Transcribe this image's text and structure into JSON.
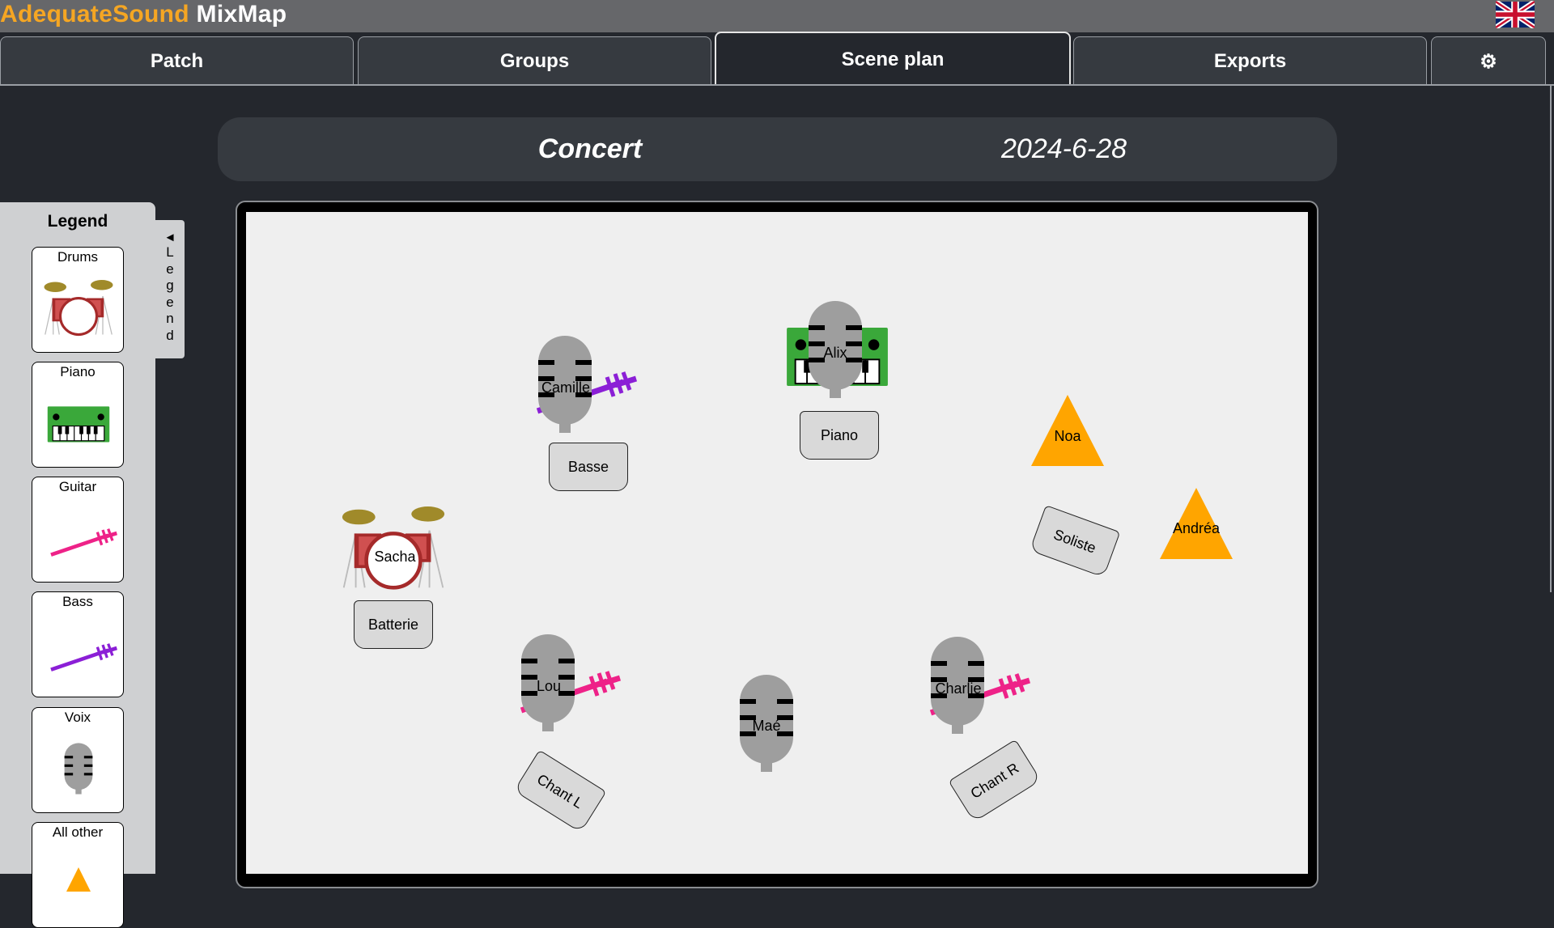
{
  "app": {
    "brand_part1": "AdequateSound",
    "brand_part2": " MixMap",
    "language_icon": "uk-flag-icon"
  },
  "tabs": [
    {
      "label": "Patch",
      "active": false
    },
    {
      "label": "Groups",
      "active": false
    },
    {
      "label": "Scene plan",
      "active": true
    },
    {
      "label": "Exports",
      "active": false
    },
    {
      "label": "⚙",
      "active": false,
      "icon": "gear-icon"
    }
  ],
  "event": {
    "name": "Concert",
    "date": "2024-6-28"
  },
  "legend": {
    "title": "Legend",
    "toggle_arrow": "◄",
    "toggle_letters": [
      "L",
      "e",
      "g",
      "e",
      "n",
      "d"
    ],
    "items": [
      {
        "label": "Drums",
        "icon": "drum-kit-icon"
      },
      {
        "label": "Piano",
        "icon": "keyboard-icon"
      },
      {
        "label": "Guitar",
        "icon": "guitar-icon"
      },
      {
        "label": "Bass",
        "icon": "bass-icon"
      },
      {
        "label": "Voix",
        "icon": "microphone-icon"
      },
      {
        "label": "All other",
        "icon": "triangle-icon"
      }
    ]
  },
  "stage": {
    "musicians": [
      {
        "name": "Camille",
        "icon": "microphone-bass-icon"
      },
      {
        "name": "Alix",
        "icon": "microphone-keyboard-icon"
      },
      {
        "name": "Noa",
        "icon": "triangle-icon"
      },
      {
        "name": "Andréa",
        "icon": "triangle-icon"
      },
      {
        "name": "Sacha",
        "icon": "drum-kit-icon"
      },
      {
        "name": "Lou",
        "icon": "microphone-guitar-icon"
      },
      {
        "name": "Maé",
        "icon": "microphone-icon"
      },
      {
        "name": "Charlie",
        "icon": "microphone-guitar-icon"
      }
    ],
    "plates": [
      "Basse",
      "Piano",
      "Soliste",
      "Batterie",
      "Chant L",
      "Chant R"
    ]
  },
  "colors": {
    "accent": "#f5a623",
    "drum_red": "#a52a2a",
    "cymbal": "#a08a2a",
    "keyboard_green": "#3aa83a",
    "bass_purple": "#8b1fd6",
    "guitar_pink": "#ee2288",
    "mic_grey": "#9e9e9e",
    "other_orange": "#ffa500"
  }
}
